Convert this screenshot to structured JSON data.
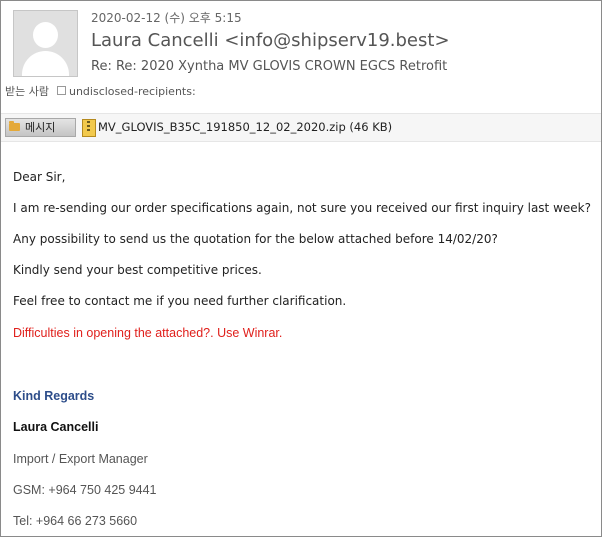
{
  "header": {
    "date": "2020-02-12 (수) 오후 5:15",
    "sender": "Laura Cancelli <info@shipserv19.best>",
    "subject": "Re: Re: 2020 Xyntha MV GLOVIS CROWN EGCS Retrofit",
    "to_label": "받는 사람",
    "to_value": "undisclosed-recipients:"
  },
  "attachments": {
    "message_tab": "메시지",
    "file_name": "MV_GLOVIS_B35C_191850_12_02_2020.zip (46 KB)"
  },
  "body": {
    "greeting": "Dear Sir,",
    "line1": "I am re-sending our order specifications again, not sure you received our first inquiry last week?",
    "line2": "Any possibility to send us the quotation for the below attached before 14/02/20?",
    "line3": "Kindly send your best competitive prices.",
    "line4": "Feel free to contact me if you need further clarification.",
    "warning": "Difficulties in opening the attached?. Use Winrar."
  },
  "signature": {
    "closing": "Kind Regards",
    "name": "Laura Cancelli",
    "title": "Import / Export Manager",
    "gsm": "GSM: +964 750 425 9441",
    "tel": "Tel: +964 66 273 5660"
  },
  "colors": {
    "warning": "#e0201c",
    "closing": "#2d4d8a"
  }
}
